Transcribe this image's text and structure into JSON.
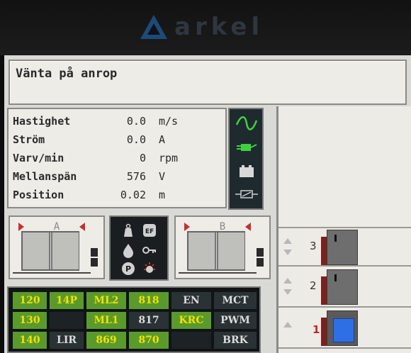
{
  "header": {
    "logo_text": "arkel"
  },
  "status": {
    "message": "Vänta på anrop"
  },
  "readings": [
    {
      "label": "Hastighet",
      "value": "0.0",
      "unit": "m/s"
    },
    {
      "label": "Ström",
      "value": "0.0",
      "unit": "A"
    },
    {
      "label": "Varv/min",
      "value": "0",
      "unit": "rpm"
    },
    {
      "label": "Mellanspän",
      "value": "576",
      "unit": "V"
    },
    {
      "label": "Position",
      "value": "0.02",
      "unit": "m"
    }
  ],
  "indicators": [
    "sine-wave-icon",
    "plug-icon",
    "battery-icon",
    "resistor-icon"
  ],
  "doors": {
    "a_label": "A",
    "b_label": "B"
  },
  "icon_panel": [
    "weight-icon",
    "ef-icon",
    "drop-icon",
    "key-icon",
    "parking-icon",
    "light-icon"
  ],
  "floors": [
    {
      "number": "3",
      "active": false
    },
    {
      "number": "2",
      "active": false
    },
    {
      "number": "1",
      "active": true
    }
  ],
  "grid": [
    [
      "120",
      "14P",
      "ML2",
      "818",
      "EN",
      "MCT"
    ],
    [
      "130",
      "",
      "ML1",
      "817",
      "KRC",
      "PWM"
    ],
    [
      "140",
      "LIR",
      "869",
      "870",
      "",
      "BRK"
    ]
  ],
  "colors": {
    "accent_green": "#5a9a2c",
    "accent_yellow": "#f2e200",
    "active_car": "#2f6fe6",
    "arrow_red": "#c53030"
  }
}
